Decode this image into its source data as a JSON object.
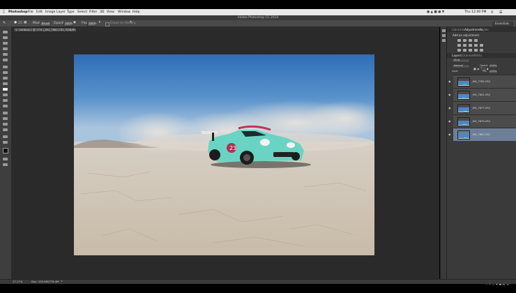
{
  "menubar": {
    "items": [
      "Photoshop",
      "File",
      "Edit",
      "Image",
      "Layer",
      "Type",
      "Select",
      "Filter",
      "3D",
      "View",
      "Window",
      "Help"
    ],
    "clock": "Thu 12:40 PM"
  },
  "titlebar": {
    "title": "Adobe Photoshop CC 2014"
  },
  "options": {
    "mode_label": "Mode:",
    "mode_value": "Brush",
    "opacity_label": "Opacity:",
    "opacity_value": "100%",
    "flow_label": "Flow:",
    "flow_value": "100%",
    "erase_history_label": "Erase to History",
    "workspace": "Essentials"
  },
  "document": {
    "tab_title": "Untitled-1 @ 17% (_MG_7862.CR2, RGB/8*)"
  },
  "panels": {
    "top_tabs": [
      "Libraries",
      "Adjustments",
      "Styles"
    ],
    "active_top_tab": "Adjustments",
    "adjust_hint": "Add an adjustment",
    "layer_tabs": [
      "Layers",
      "Channels",
      "Paths"
    ],
    "active_layer_tab": "Layers",
    "kind_label": "Kind",
    "blend_mode": "Normal",
    "opacity_label": "Opacity:",
    "opacity_value": "100%",
    "lock_label": "Lock:",
    "fill_label": "Fill:",
    "fill_value": "100%",
    "layers": [
      {
        "name": "_MG_7785.CR2"
      },
      {
        "name": "_MG_7841.CR2"
      },
      {
        "name": "_MG_7877.CR2"
      },
      {
        "name": "_MG_7879.CR2"
      },
      {
        "name": "_MG_7862.CR2"
      }
    ]
  },
  "status": {
    "zoom": "17.17%",
    "doc": "Doc: 155.8M/776.4M"
  },
  "colors": {
    "selected_layer": "#6d7f97",
    "sky": "#3f7fc4",
    "car": "#68d6c3"
  }
}
